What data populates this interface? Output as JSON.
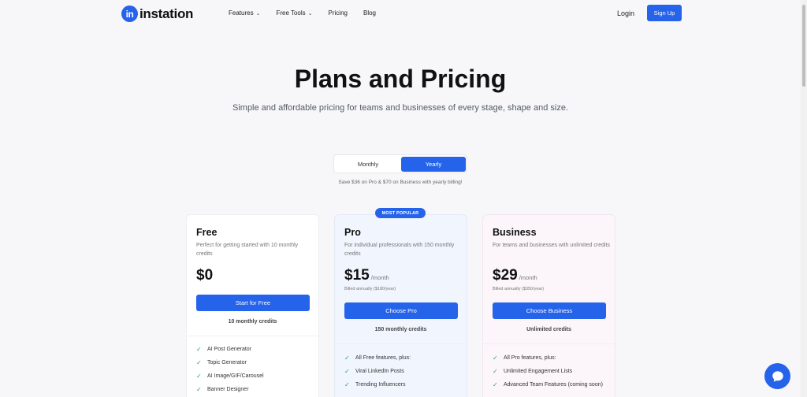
{
  "brand": {
    "name": "instation",
    "mark": "in",
    "accent": "#2563eb"
  },
  "nav": {
    "items": [
      {
        "label": "Features",
        "dropdown": true
      },
      {
        "label": "Free Tools",
        "dropdown": true
      },
      {
        "label": "Pricing",
        "dropdown": false
      },
      {
        "label": "Blog",
        "dropdown": false
      }
    ],
    "login": "Login",
    "signup": "Sign Up"
  },
  "hero": {
    "title": "Plans and Pricing",
    "subtitle": "Simple and affordable pricing for teams and businesses of every stage, shape and size."
  },
  "billing_toggle": {
    "monthly": "Monthly",
    "yearly": "Yearly",
    "selected": "Yearly",
    "note": "Save $36 on Pro & $70 on Business with yearly billing!"
  },
  "badge": "MOST POPULAR",
  "plans": [
    {
      "name": "Free",
      "description": "Perfect for getting started with 10 monthly credits",
      "price": "$0",
      "per": "",
      "billed": "",
      "button": "Start for Free",
      "credits": "10 monthly credits",
      "features": [
        "AI Post Generator",
        "Topic Generator",
        "AI Image/GIF/Carousel",
        "Banner Designer"
      ]
    },
    {
      "name": "Pro",
      "description": "For individual professionals with 150 monthly credits",
      "price": "$15",
      "per": "/month",
      "billed": "Billed annually ($180/year)",
      "button": "Choose Pro",
      "credits": "150 monthly credits",
      "features": [
        "All Free features, plus:",
        "Viral LinkedIn Posts",
        "Trending Influencers"
      ]
    },
    {
      "name": "Business",
      "description": "For teams and businesses with unlimited credits",
      "price": "$29",
      "per": "/month",
      "billed": "Billed annually ($350/year)",
      "button": "Choose Business",
      "credits": "Unlimited credits",
      "features": [
        "All Pro features, plus:",
        "Unlimited Engagement Lists",
        "Advanced Team Features (coming soon)"
      ]
    }
  ],
  "icons": {
    "check": "check-icon",
    "chat": "chat-bubble-icon",
    "chevron": "chevron-down-icon"
  }
}
